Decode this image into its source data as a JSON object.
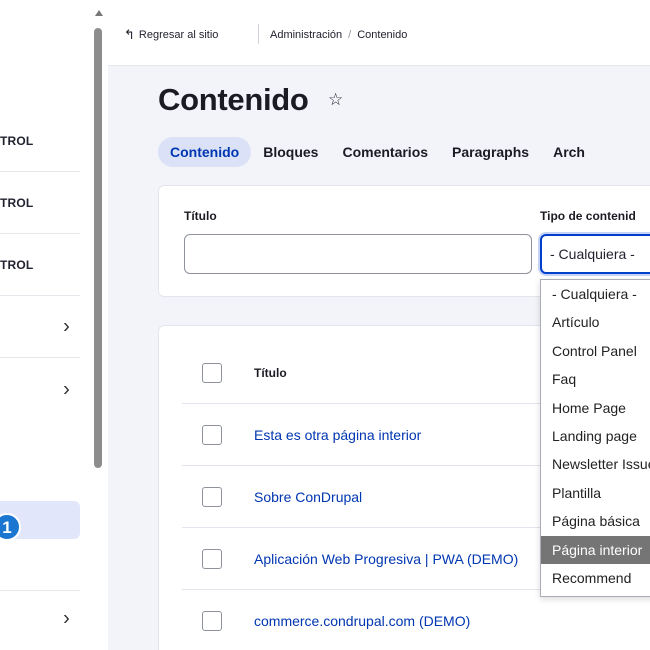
{
  "sidebar": {
    "items": [
      {
        "label": "TROL",
        "has_chevron": false
      },
      {
        "label": "TROL",
        "has_chevron": false
      },
      {
        "label": "TROL",
        "has_chevron": false
      },
      {
        "label": "",
        "has_chevron": true
      },
      {
        "label": "",
        "has_chevron": true
      },
      {
        "label": "",
        "has_chevron": true
      }
    ],
    "chevron": "›",
    "badge_number": "1"
  },
  "breadcrumb": {
    "back_label": "Regresar al sitio",
    "back_icon": "↰",
    "trail": [
      "Administración",
      "Contenido"
    ],
    "separator": "/"
  },
  "page": {
    "title": "Contenido",
    "star": "☆"
  },
  "tabs": [
    "Contenido",
    "Bloques",
    "Comentarios",
    "Paragraphs",
    "Arch"
  ],
  "filter": {
    "title_label": "Título",
    "title_value": "",
    "type_label": "Tipo de contenid",
    "type_selected": "- Cualquiera -",
    "type_options": [
      "- Cualquiera -",
      "Artículo",
      "Control Panel",
      "Faq",
      "Home Page",
      "Landing page",
      "Newsletter Issue",
      "Plantilla",
      "Página básica",
      "Página interior",
      "Recommend"
    ],
    "highlighted_index": 9
  },
  "table": {
    "header_title": "Título",
    "rows": [
      "Esta es otra página interior",
      "Sobre ConDrupal",
      "Aplicación Web Progresiva | PWA (DEMO)",
      "commerce.condrupal.com (DEMO)"
    ]
  },
  "colors": {
    "accent": "#003ecc",
    "link": "#0036b1",
    "tab_active_bg": "#dbe2f7",
    "badge": "#1b76d1"
  }
}
